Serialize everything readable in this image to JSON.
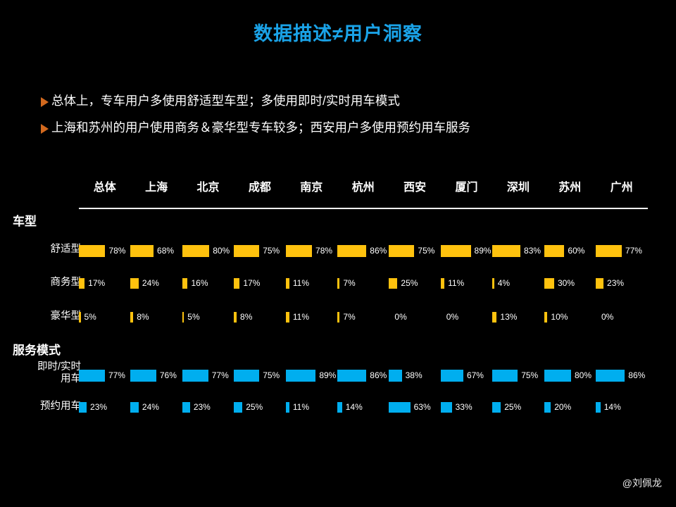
{
  "slide": {
    "title": "数据描述≠用户洞察",
    "title_color": "#1aa3e8",
    "background_color": "#000000",
    "watermark": "@刘佩龙"
  },
  "bullets": [
    {
      "marker": "triangle-right-icon",
      "text": "总体上，专车用户多使用舒适型车型；多使用即时/实时用车模式"
    },
    {
      "marker": "triangle-right-icon",
      "text": "上海和苏州的用户使用商务＆豪华型专车较多；西安用户多使用预约用车服务"
    }
  ],
  "chart_data": {
    "type": "bar",
    "title": "数据描述≠用户洞察",
    "orientation": "horizontal",
    "grid": false,
    "legend": false,
    "value_suffix": "%",
    "xlim": [
      0,
      100
    ],
    "categories": [
      "总体",
      "上海",
      "北京",
      "成都",
      "南京",
      "杭州",
      "西安",
      "厦门",
      "深圳",
      "苏州",
      "广州"
    ],
    "sections": [
      {
        "name": "车型",
        "color": "#ffc20e",
        "series": [
          {
            "name": "舒适型",
            "values": [
              78,
              68,
              80,
              75,
              78,
              86,
              75,
              89,
              83,
              60,
              77
            ],
            "labels": [
              "78%",
              "68%",
              "80%",
              "75%",
              "78%",
              "86%",
              "75%",
              "89%",
              "83%",
              "60%",
              "77%"
            ]
          },
          {
            "name": "商务型",
            "values": [
              17,
              24,
              16,
              17,
              11,
              7,
              25,
              11,
              4,
              30,
              23
            ],
            "labels": [
              "17%",
              "24%",
              "16%",
              "17%",
              "11%",
              "7%",
              "25%",
              "11%",
              "4%",
              "30%",
              "23%"
            ]
          },
          {
            "name": "豪华型",
            "values": [
              5,
              8,
              5,
              8,
              11,
              7,
              0,
              0,
              13,
              10,
              0
            ],
            "labels": [
              "5%",
              "8%",
              "5%",
              "8%",
              "11%",
              "7%",
              "0%",
              "0%",
              "13%",
              "10%",
              "0%"
            ]
          }
        ]
      },
      {
        "name": "服务模式",
        "color": "#00aeef",
        "series": [
          {
            "name": "即时/实时用车",
            "name_lines": [
              "即时/实时",
              "用车"
            ],
            "values": [
              77,
              76,
              77,
              75,
              89,
              86,
              38,
              67,
              75,
              80,
              86
            ],
            "labels": [
              "77%",
              "76%",
              "77%",
              "75%",
              "89%",
              "86%",
              "38%",
              "67%",
              "75%",
              "80%",
              "86%"
            ]
          },
          {
            "name": "预约用车",
            "values": [
              23,
              24,
              23,
              25,
              11,
              14,
              63,
              33,
              25,
              20,
              14
            ],
            "labels": [
              "23%",
              "24%",
              "23%",
              "25%",
              "11%",
              "14%",
              "63%",
              "33%",
              "25%",
              "20%",
              "14%"
            ]
          }
        ]
      }
    ]
  }
}
